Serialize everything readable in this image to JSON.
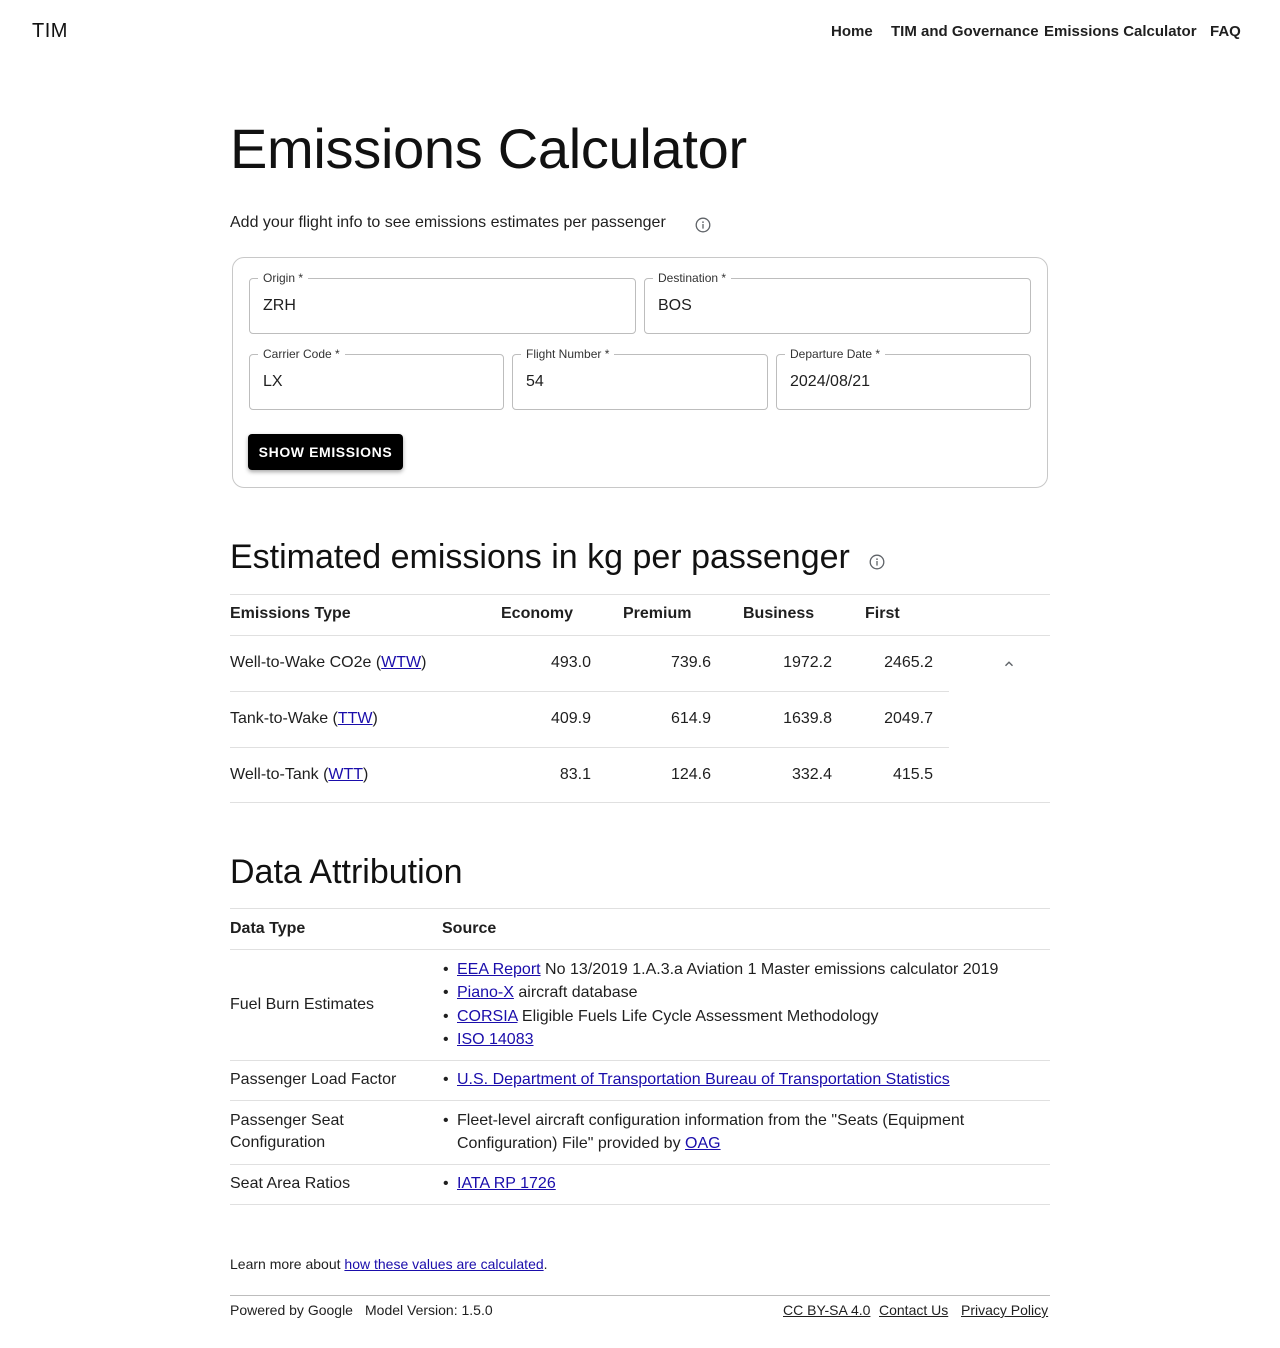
{
  "header": {
    "brand": "TIM",
    "nav": [
      "Home",
      "TIM and Governance",
      "Emissions Calculator",
      "FAQ"
    ]
  },
  "page": {
    "title": "Emissions Calculator",
    "subtitle": "Add your flight info to see emissions estimates per passenger"
  },
  "form": {
    "origin_label": "Origin *",
    "origin_value": "ZRH",
    "destination_label": "Destination *",
    "destination_value": "BOS",
    "carrier_label": "Carrier Code *",
    "carrier_value": "LX",
    "flight_label": "Flight Number *",
    "flight_value": "54",
    "date_label": "Departure Date *",
    "date_value": "2024/08/21",
    "submit_label": "SHOW EMISSIONS"
  },
  "emissions": {
    "heading": "Estimated emissions in kg per passenger",
    "columns": [
      "Emissions Type",
      "Economy",
      "Premium",
      "Business",
      "First"
    ],
    "rows": [
      {
        "prefix": "Well-to-Wake CO2e (",
        "abbr": "WTW",
        "suffix": ")",
        "values": [
          "493.0",
          "739.6",
          "1972.2",
          "2465.2"
        ]
      },
      {
        "prefix": "Tank-to-Wake (",
        "abbr": "TTW",
        "suffix": ")",
        "values": [
          "409.9",
          "614.9",
          "1639.8",
          "2049.7"
        ]
      },
      {
        "prefix": "Well-to-Tank (",
        "abbr": "WTT",
        "suffix": ")",
        "values": [
          "83.1",
          "124.6",
          "332.4",
          "415.5"
        ]
      }
    ]
  },
  "attribution": {
    "heading": "Data Attribution",
    "columns": [
      "Data Type",
      "Source"
    ],
    "rows": [
      {
        "type": "Fuel Burn Estimates",
        "sources": [
          {
            "link": "EEA Report",
            "text": " No 13/2019 1.A.3.a Aviation 1 Master emissions calculator 2019"
          },
          {
            "link": "Piano-X",
            "text": " aircraft database"
          },
          {
            "link": "CORSIA",
            "text": " Eligible Fuels Life Cycle Assessment Methodology"
          },
          {
            "link": "ISO 14083",
            "text": ""
          }
        ]
      },
      {
        "type": "Passenger Load Factor",
        "sources": [
          {
            "link": "U.S. Department of Transportation Bureau of Transportation Statistics",
            "text": ""
          }
        ]
      },
      {
        "type": "Passenger Seat Configuration",
        "sources": [
          {
            "pre": "Fleet-level aircraft configuration information from the \"Seats (Equipment Configuration) File\" provided by ",
            "link": "OAG",
            "text": ""
          }
        ]
      },
      {
        "type": "Seat Area Ratios",
        "sources": [
          {
            "link": "IATA RP 1726",
            "text": ""
          }
        ]
      }
    ]
  },
  "learn_more": {
    "prefix": "Learn more about ",
    "link": "how these values are calculated",
    "suffix": "."
  },
  "footer": {
    "powered": "Powered by Google",
    "model_version": "Model Version: 1.5.0",
    "links": [
      "CC BY-SA 4.0",
      "Contact Us",
      "Privacy Policy"
    ]
  },
  "icons": {
    "info": "info-icon",
    "expand": "chevron-up-icon"
  },
  "colors": {
    "link": "#1a0dab",
    "button_bg": "#000000",
    "button_text": "#ffffff",
    "divider": "#e0e0e0"
  }
}
